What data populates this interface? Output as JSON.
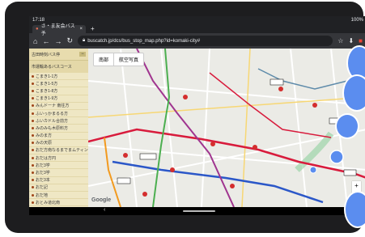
{
  "status": {
    "time": "17:18",
    "right": "100%"
  },
  "tab": {
    "title": "さ・ま友会バス予",
    "close": "×"
  },
  "newtab": "+",
  "address": {
    "url": "buscatch.jp/dcs/bus_stop_map.php?id=komaki-city#"
  },
  "sidebar": {
    "title": "古田時刻バス停",
    "collapse": "−",
    "section": "市運輸あるバスコース",
    "courses": [
      "こまき1-1方",
      "こまき1-5方",
      "こまき1-8方",
      "こまき1-9方",
      "みんドーナ 南往方",
      "ふいっかまるる方",
      "ふいカドル合前方",
      "みのみも木原料方",
      "みのま方",
      "みの天原",
      "おだ方南なるまでまムティン",
      "おだは方円",
      "おだ3学",
      "おだ3学",
      "おだ3本",
      "おだ記",
      "おだ地",
      "おとみ道北南"
    ]
  },
  "map": {
    "tab_a": "南部",
    "tab_b": "航空写真",
    "google": "Google",
    "zoom_in": "+",
    "zoom_out": "−"
  },
  "navbar": {
    "back": "‹"
  },
  "colors": {
    "route_red": "#d81b3c",
    "route_blue": "#2b57c8",
    "route_green": "#4caf50",
    "route_purple": "#a0358f",
    "route_orange": "#f29a1f",
    "route_gray": "#5e8baa"
  }
}
